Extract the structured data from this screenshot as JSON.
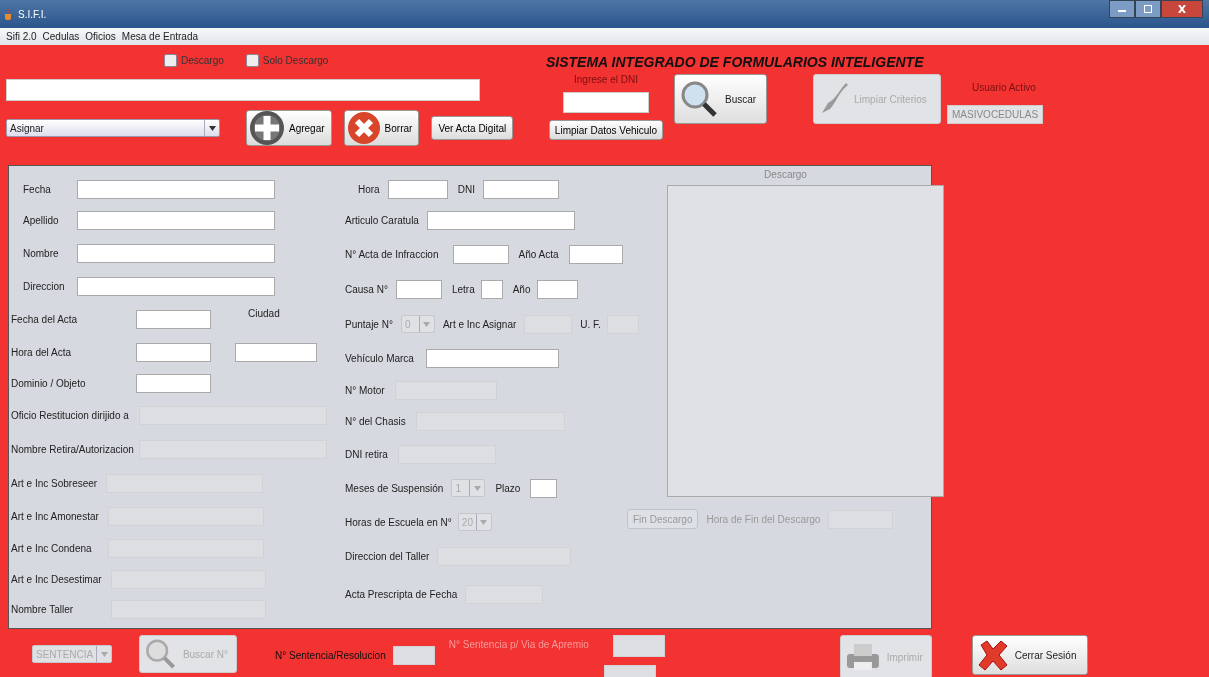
{
  "window": {
    "title": "S.I.F.I."
  },
  "menu": [
    "Sifi 2.0",
    "Cedulas",
    "Oficios",
    "Mesa de Entrada"
  ],
  "checkboxes": [
    {
      "label": "Descargo",
      "checked": false
    },
    {
      "label": "Solo Descargo",
      "checked": false
    }
  ],
  "app_title": "SISTEMA INTEGRADO DE FORMULARIOS INTELIGENTE",
  "assign_combo": {
    "value": "Asignar"
  },
  "buttons": [
    {
      "label": "Agregar",
      "kind": "add"
    },
    {
      "label": "Borrar",
      "kind": "delete"
    },
    {
      "label": "Ver Acta Digital",
      "kind": "plain"
    }
  ],
  "dni_search": {
    "label": "Ingrese el DNI",
    "clear_button": "Limpiar Datos Vehiculo"
  },
  "search_button": {
    "label": "Buscar",
    "disabled": false
  },
  "clear_criteria_button": {
    "label": "Limpiar Criterios",
    "disabled": true
  },
  "active_user": {
    "label": "Usuario Activo",
    "value": "MASIVOCEDULAS"
  },
  "form_left": [
    [
      {
        "kind": "label",
        "text": "Fecha"
      },
      {
        "kind": "field",
        "disabled": false
      }
    ],
    [
      {
        "kind": "label",
        "text": "Apellido"
      },
      {
        "kind": "field",
        "disabled": false
      }
    ],
    [
      {
        "kind": "label",
        "text": "Nombre"
      },
      {
        "kind": "field",
        "disabled": false
      }
    ],
    [
      {
        "kind": "label",
        "text": "Direccion"
      },
      {
        "kind": "field",
        "disabled": false
      }
    ],
    [
      {
        "kind": "label",
        "text": "Fecha del Acta"
      },
      {
        "kind": "field",
        "disabled": false
      },
      {
        "kind": "label",
        "text": "Ciudad"
      }
    ],
    [
      {
        "kind": "label",
        "text": "Hora del Acta"
      },
      {
        "kind": "field",
        "disabled": false
      },
      {
        "kind": "field",
        "disabled": false
      }
    ],
    [
      {
        "kind": "label",
        "text": "Dominio / Objeto"
      },
      {
        "kind": "field",
        "disabled": false
      }
    ],
    [
      {
        "kind": "label",
        "text": "Oficio Restitucion dirijido a"
      },
      {
        "kind": "field",
        "disabled": true
      }
    ],
    [
      {
        "kind": "label",
        "text": "Nombre Retira/Autorizacion"
      },
      {
        "kind": "field",
        "disabled": true
      }
    ],
    [
      {
        "kind": "label",
        "text": "Art e Inc Sobreseer"
      },
      {
        "kind": "field",
        "disabled": true
      }
    ],
    [
      {
        "kind": "label",
        "text": "Art e Inc Amonestar"
      },
      {
        "kind": "field",
        "disabled": true
      }
    ],
    [
      {
        "kind": "label",
        "text": "Art e Inc Condena"
      },
      {
        "kind": "field",
        "disabled": true
      }
    ],
    [
      {
        "kind": "label",
        "text": "Art e Inc Desestimar"
      },
      {
        "kind": "field",
        "disabled": true
      }
    ],
    [
      {
        "kind": "label",
        "text": "Nombre Taller"
      },
      {
        "kind": "field",
        "disabled": true
      }
    ]
  ],
  "form_middle": [
    [
      {
        "kind": "label",
        "text": "Hora"
      },
      {
        "kind": "field",
        "disabled": false
      },
      {
        "kind": "label",
        "text": "DNI"
      },
      {
        "kind": "field",
        "disabled": false
      }
    ],
    [
      {
        "kind": "label",
        "text": "Articulo Caratula"
      },
      {
        "kind": "field",
        "disabled": false
      }
    ],
    [
      {
        "kind": "label",
        "text": "N° Acta de Infraccion"
      },
      {
        "kind": "field",
        "disabled": false
      },
      {
        "kind": "label",
        "text": "Año Acta"
      },
      {
        "kind": "field",
        "disabled": false
      }
    ],
    [
      {
        "kind": "label",
        "text": "Causa N°"
      },
      {
        "kind": "field",
        "disabled": false
      },
      {
        "kind": "label",
        "text": "Letra"
      },
      {
        "kind": "field",
        "disabled": false
      },
      {
        "kind": "label",
        "text": "Año"
      },
      {
        "kind": "field",
        "disabled": false
      }
    ],
    [
      {
        "kind": "label",
        "text": "Puntaje N°"
      },
      {
        "kind": "combo",
        "value": "0",
        "disabled": true
      },
      {
        "kind": "label",
        "text": "Art e Inc Asignar"
      },
      {
        "kind": "field",
        "disabled": true
      },
      {
        "kind": "label",
        "text": "U. F."
      },
      {
        "kind": "field",
        "disabled": true
      }
    ],
    [
      {
        "kind": "label",
        "text": "Vehículo Marca"
      },
      {
        "kind": "field",
        "disabled": false
      }
    ],
    [
      {
        "kind": "label",
        "text": "N° Motor"
      },
      {
        "kind": "field",
        "disabled": true
      }
    ],
    [
      {
        "kind": "label",
        "text": "N° del Chasis"
      },
      {
        "kind": "field",
        "disabled": true
      }
    ],
    [
      {
        "kind": "label",
        "text": "DNI retira"
      },
      {
        "kind": "field",
        "disabled": true
      }
    ],
    [
      {
        "kind": "label",
        "text": "Meses de Suspensión"
      },
      {
        "kind": "combo",
        "value": "1",
        "disabled": true
      },
      {
        "kind": "label",
        "text": "Plazo"
      },
      {
        "kind": "field",
        "disabled": false
      }
    ],
    [
      {
        "kind": "label",
        "text": "Horas de Escuela en N°"
      },
      {
        "kind": "combo",
        "value": "20",
        "disabled": true
      }
    ],
    [
      {
        "kind": "label",
        "text": "Direccion del Taller"
      },
      {
        "kind": "field",
        "disabled": true
      }
    ],
    [
      {
        "kind": "label",
        "text": "Acta Prescripta de Fecha"
      },
      {
        "kind": "field",
        "disabled": true
      }
    ]
  ],
  "descargo": {
    "title": "Descargo",
    "end_button": {
      "label": "Fin Descargo",
      "disabled": true
    },
    "end_time_label": "Hora de Fin del Descargo"
  },
  "bottom": {
    "type_combo": {
      "value": "SENTENCIA",
      "disabled": true
    },
    "search_button": {
      "label": "Buscar N°",
      "disabled": true
    },
    "resolution_label": "N° Sentencia/Resolucion",
    "apremio_label": "N° Sentencia p/ Via de Apremio",
    "print_button": {
      "label": "Imprimir",
      "disabled": true
    },
    "logout_button": {
      "label": "Cerrar Sesión",
      "disabled": false
    }
  }
}
